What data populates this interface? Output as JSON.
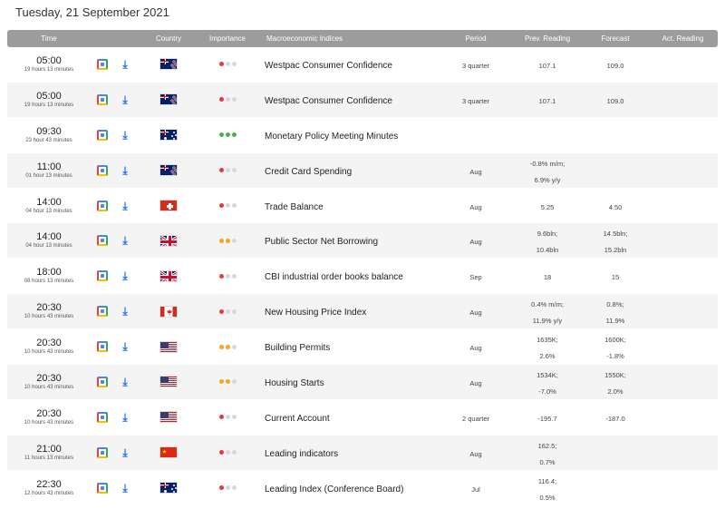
{
  "title": "Tuesday, 21 September 2021",
  "headers": {
    "time": "Time",
    "country": "Country",
    "importance": "Importance",
    "indices": "Macroeconomic Indices",
    "period": "Period",
    "prev": "Prev. Reading",
    "forecast": "Forecast",
    "actual": "Act. Reading"
  },
  "rows": [
    {
      "time": "05:00",
      "sub": "19 hours 13 minutes",
      "flag": "nz",
      "importance": "low",
      "name": "Westpac Consumer Confidence",
      "period": "3 quarter",
      "prev": "107.1",
      "forecast": "109.0",
      "actual": ""
    },
    {
      "time": "05:00",
      "sub": "19 hours 13 minutes",
      "flag": "nz",
      "importance": "low",
      "name": "Westpac Consumer Confidence",
      "period": "3 quarter",
      "prev": "107.1",
      "forecast": "109.0",
      "actual": ""
    },
    {
      "time": "09:30",
      "sub": "23 hour 43 minutes",
      "flag": "au",
      "importance": "high",
      "name": "Monetary Policy Meeting Minutes",
      "period": "",
      "prev": "",
      "forecast": "",
      "actual": ""
    },
    {
      "time": "11:00",
      "sub": "01 hour 13 minutes",
      "flag": "nz",
      "importance": "low",
      "name": "Credit Card Spending",
      "period": "Aug",
      "prev": "-0.8% m/m;\n6.9% y/y",
      "forecast": "",
      "actual": ""
    },
    {
      "time": "14:00",
      "sub": "04 hour 13 minutes",
      "flag": "ch",
      "importance": "low",
      "name": "Trade Balance",
      "period": "Aug",
      "prev": "5.25",
      "forecast": "4.50",
      "actual": ""
    },
    {
      "time": "14:00",
      "sub": "04 hour 13 minutes",
      "flag": "uk",
      "importance": "medium",
      "name": "Public Sector Net Borrowing",
      "period": "Aug",
      "prev": "9.6bln;\n10.4bln",
      "forecast": "14.5bln;\n15.2bln",
      "actual": ""
    },
    {
      "time": "18:00",
      "sub": "08 hours 13 minutes",
      "flag": "uk",
      "importance": "low",
      "name": "CBI industrial order books balance",
      "period": "Sep",
      "prev": "18",
      "forecast": "15",
      "actual": ""
    },
    {
      "time": "20:30",
      "sub": "10 hours 43 minutes",
      "flag": "ca",
      "importance": "low",
      "name": "New Housing Price Index",
      "period": "Aug",
      "prev": "0.4% m/m;\n11.9% y/y",
      "forecast": "0.8%;\n11.9%",
      "actual": ""
    },
    {
      "time": "20:30",
      "sub": "10 hours 43 minutes",
      "flag": "us",
      "importance": "medium",
      "name": "Building Permits",
      "period": "Aug",
      "prev": "1635K;\n2.6%",
      "forecast": "1600K;\n-1.8%",
      "actual": ""
    },
    {
      "time": "20:30",
      "sub": "10 hours 43 minutes",
      "flag": "us",
      "importance": "medium",
      "name": "Housing Starts",
      "period": "Aug",
      "prev": "1534K;\n-7.0%",
      "forecast": "1550K;\n2.0%",
      "actual": ""
    },
    {
      "time": "20:30",
      "sub": "10 hours 43 minutes",
      "flag": "us",
      "importance": "low",
      "name": "Current Account",
      "period": "2 quarter",
      "prev": "-195.7",
      "forecast": "-187.0",
      "actual": ""
    },
    {
      "time": "21:00",
      "sub": "11 hours 13 minutes",
      "flag": "cn",
      "importance": "low",
      "name": "Leading indicators",
      "period": "Aug",
      "prev": "162.5;\n0.7%",
      "forecast": "",
      "actual": ""
    },
    {
      "time": "22:30",
      "sub": "12 hours 43 minutes",
      "flag": "au",
      "importance": "low",
      "name": "Leading Index (Conference Board)",
      "period": "Jul",
      "prev": "116.4;\n0.5%",
      "forecast": "",
      "actual": ""
    }
  ],
  "icons": {
    "calendar": "google-calendar-icon",
    "download": "download-icon"
  },
  "colors": {
    "header_bg": "#9c9c9c",
    "importance_low": "#e53935",
    "importance_medium": "#f5a623",
    "importance_high": "#4caf50",
    "dot_inactive": "#d8d8d8"
  }
}
